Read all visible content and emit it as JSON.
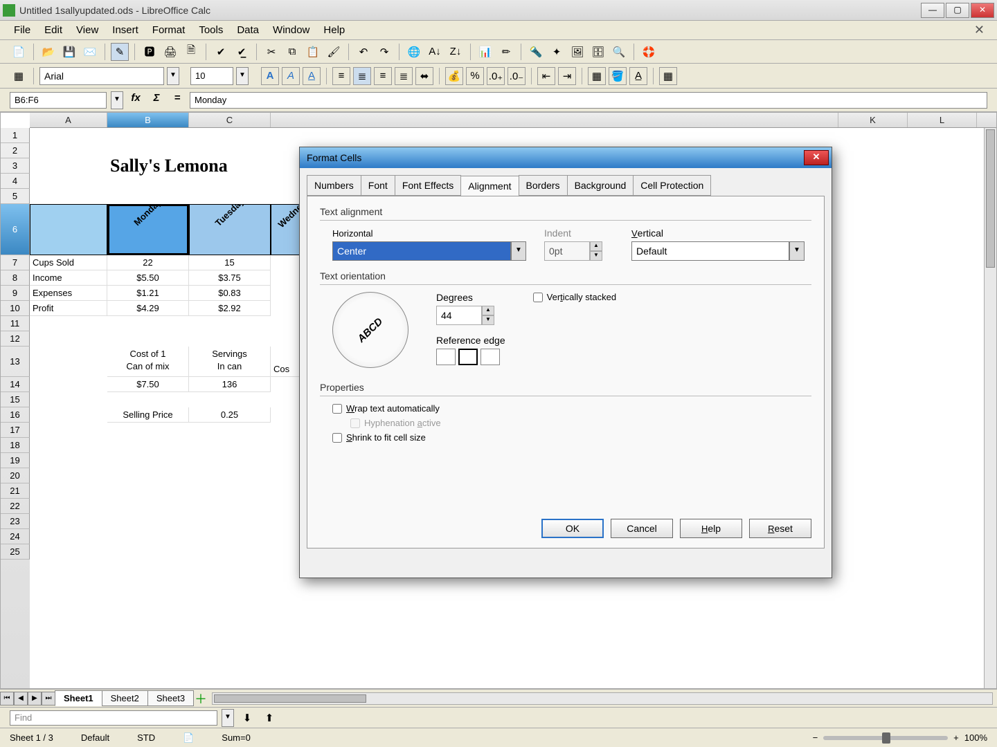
{
  "window": {
    "title": "Untitled 1sallyupdated.ods - LibreOffice Calc"
  },
  "menu": [
    "File",
    "Edit",
    "View",
    "Insert",
    "Format",
    "Tools",
    "Data",
    "Window",
    "Help"
  ],
  "font": {
    "name": "Arial",
    "size": "10"
  },
  "cellRef": "B6:F6",
  "formula": "Monday",
  "columns": [
    "A",
    "B",
    "C",
    "K",
    "L"
  ],
  "rows6label": "6",
  "sheet": {
    "title": "Sally's Lemona",
    "days": [
      "Monday",
      "Tuesday",
      "Wednesd"
    ],
    "rows": {
      "r1": "1",
      "r2": "2",
      "r3": "3",
      "r4": "4",
      "r5": "5",
      "r6": "6",
      "r7": "7",
      "r8": "8",
      "r9": "9",
      "r10": "10",
      "r11": "11",
      "r12": "12",
      "r13": "13",
      "r14": "14",
      "r15": "15",
      "r16": "16",
      "r17": "17",
      "r18": "18",
      "r19": "19",
      "r20": "20",
      "r21": "21",
      "r22": "22",
      "r23": "23",
      "r24": "24",
      "r25": "25"
    },
    "labels": {
      "cups": "Cups Sold",
      "income": "Income",
      "expenses": "Expenses",
      "profit": "Profit",
      "cost1": "Cost of 1",
      "canmix": "Can of mix",
      "servings": "Servings",
      "incan": "In can",
      "cos": "Cos",
      "sellprice": "Selling Price"
    },
    "vals": {
      "cupsB": "22",
      "cupsC": "15",
      "incB": "$5.50",
      "incC": "$3.75",
      "expB": "$1.21",
      "expC": "$0.83",
      "prB": "$4.29",
      "prC": "$2.92",
      "costB": "$7.50",
      "servC": "136",
      "spC": "0.25"
    }
  },
  "tabs": {
    "s1": "Sheet1",
    "s2": "Sheet2",
    "s3": "Sheet3"
  },
  "find": {
    "placeholder": "Find"
  },
  "status": {
    "sheet": "Sheet 1 / 3",
    "style": "Default",
    "mode": "STD",
    "sum": "Sum=0",
    "zoom": "100%"
  },
  "dialog": {
    "title": "Format Cells",
    "tabs": [
      "Numbers",
      "Font",
      "Font Effects",
      "Alignment",
      "Borders",
      "Background",
      "Cell Protection"
    ],
    "activeTab": "Alignment",
    "sec_align": "Text alignment",
    "horiLabel": "Horizontal",
    "horiValue": "Center",
    "indentLabel": "Indent",
    "indentValue": "0pt",
    "vertLabel": "Vertical",
    "vertValue": "Default",
    "sec_orient": "Text orientation",
    "degreesLabel": "Degrees",
    "degreesValue": "44",
    "vstackLabel": "Vertically stacked",
    "refedgeLabel": "Reference edge",
    "sec_prop": "Properties",
    "wrapLabel": "Wrap text automatically",
    "hyphLabel": "Hyphenation active",
    "shrinkLabel": "Shrink to fit cell size",
    "buttons": {
      "ok": "OK",
      "cancel": "Cancel",
      "help": "Help",
      "reset": "Reset"
    },
    "abcd": "ABCD"
  }
}
